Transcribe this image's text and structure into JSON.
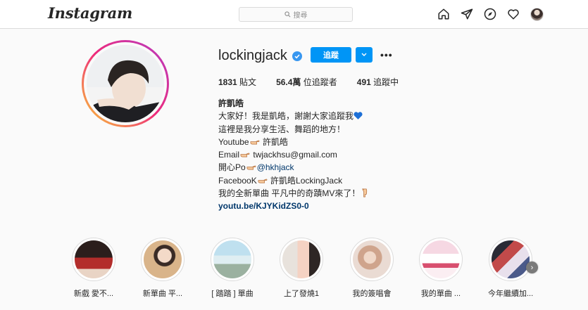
{
  "header": {
    "logo": "Instagram",
    "search_placeholder": "搜尋",
    "icons": [
      "home-icon",
      "direct-icon",
      "explore-icon",
      "heart-icon",
      "profile-avatar"
    ]
  },
  "profile": {
    "username": "lockingjack",
    "verified": true,
    "follow_label": "追蹤",
    "stats": {
      "posts_value": "1831",
      "posts_label": "貼文",
      "followers_value": "56.4萬",
      "followers_label": "位追蹤者",
      "following_value": "491",
      "following_label": "追蹤中"
    },
    "bio": {
      "name": "許凱皓",
      "line1": "大家好！我是凱皓，謝謝大家追蹤我",
      "line2": "這裡是我分享生活、舞蹈的地方！",
      "line3_a": "Youtube",
      "line3_b": "許凱皓",
      "line4_a": "Email",
      "line4_b": "twjackhsu@gmail.com",
      "line5_a": "開心Po",
      "line5_b": "@hkhjack",
      "line6_a": "FacebooK",
      "line6_b": "許凱皓LockingJack",
      "line7": "我的全新單曲 平凡中的奇蹟MV來了！",
      "link": "youtu.be/KJYKidZS0-0"
    }
  },
  "highlights": [
    {
      "label": "新戲 愛不..."
    },
    {
      "label": "新單曲 平..."
    },
    {
      "label": "[ 踏踏 ] 單曲"
    },
    {
      "label": "上了發燒1"
    },
    {
      "label": "我的簽唱會"
    },
    {
      "label": "我的單曲 ..."
    },
    {
      "label": "今年繼續加..."
    }
  ],
  "colors": {
    "accent": "#0095f6",
    "link": "#00376b",
    "verified": "#3897f0"
  }
}
